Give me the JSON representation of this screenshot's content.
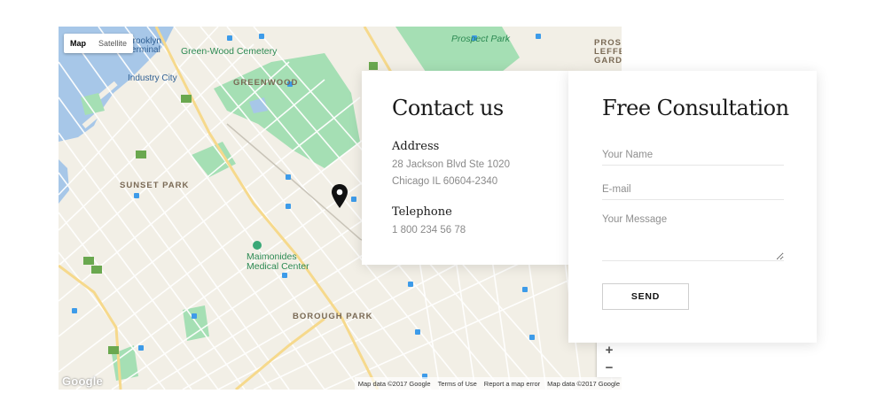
{
  "map": {
    "type_buttons": [
      "Map",
      "Satellite"
    ],
    "labels": {
      "brooklyn_terminal": "Brooklyn\nTerminal",
      "greenwood_cemetery": "Green-Wood Cemetery",
      "industry_city": "Industry City",
      "greenwood": "GREENWOOD",
      "prospect_park": "Prospect Park",
      "sunset_park": "SUNSET PARK",
      "maimonides": "Maimonides\nMedical Center",
      "borough_park": "BOROUGH PARK",
      "prosp_lefferts": "PROSF\nLEFFE\nGARD"
    },
    "zoom_in": "+",
    "zoom_out": "−",
    "google": "Google",
    "attribution": [
      "Map data ©2017 Google",
      "Terms of Use",
      "Report a map error",
      "Map data ©2017 Google"
    ],
    "colors": {
      "land": "#f2efe6",
      "park": "#a5dfb4",
      "water": "#a7c7e8",
      "road": "#ffffff",
      "highway": "#f6d98c"
    }
  },
  "contact": {
    "title": "Contact us",
    "address_label": "Address",
    "address_line1": "28 Jackson Blvd Ste 1020",
    "address_line2": "Chicago IL 60604-2340",
    "telephone_label": "Telephone",
    "telephone": "1 800 234 56 78"
  },
  "consultation": {
    "title": "Free Consultation",
    "name_placeholder": "Your Name",
    "email_placeholder": "E-mail",
    "message_placeholder": "Your Message",
    "send_label": "SEND"
  }
}
